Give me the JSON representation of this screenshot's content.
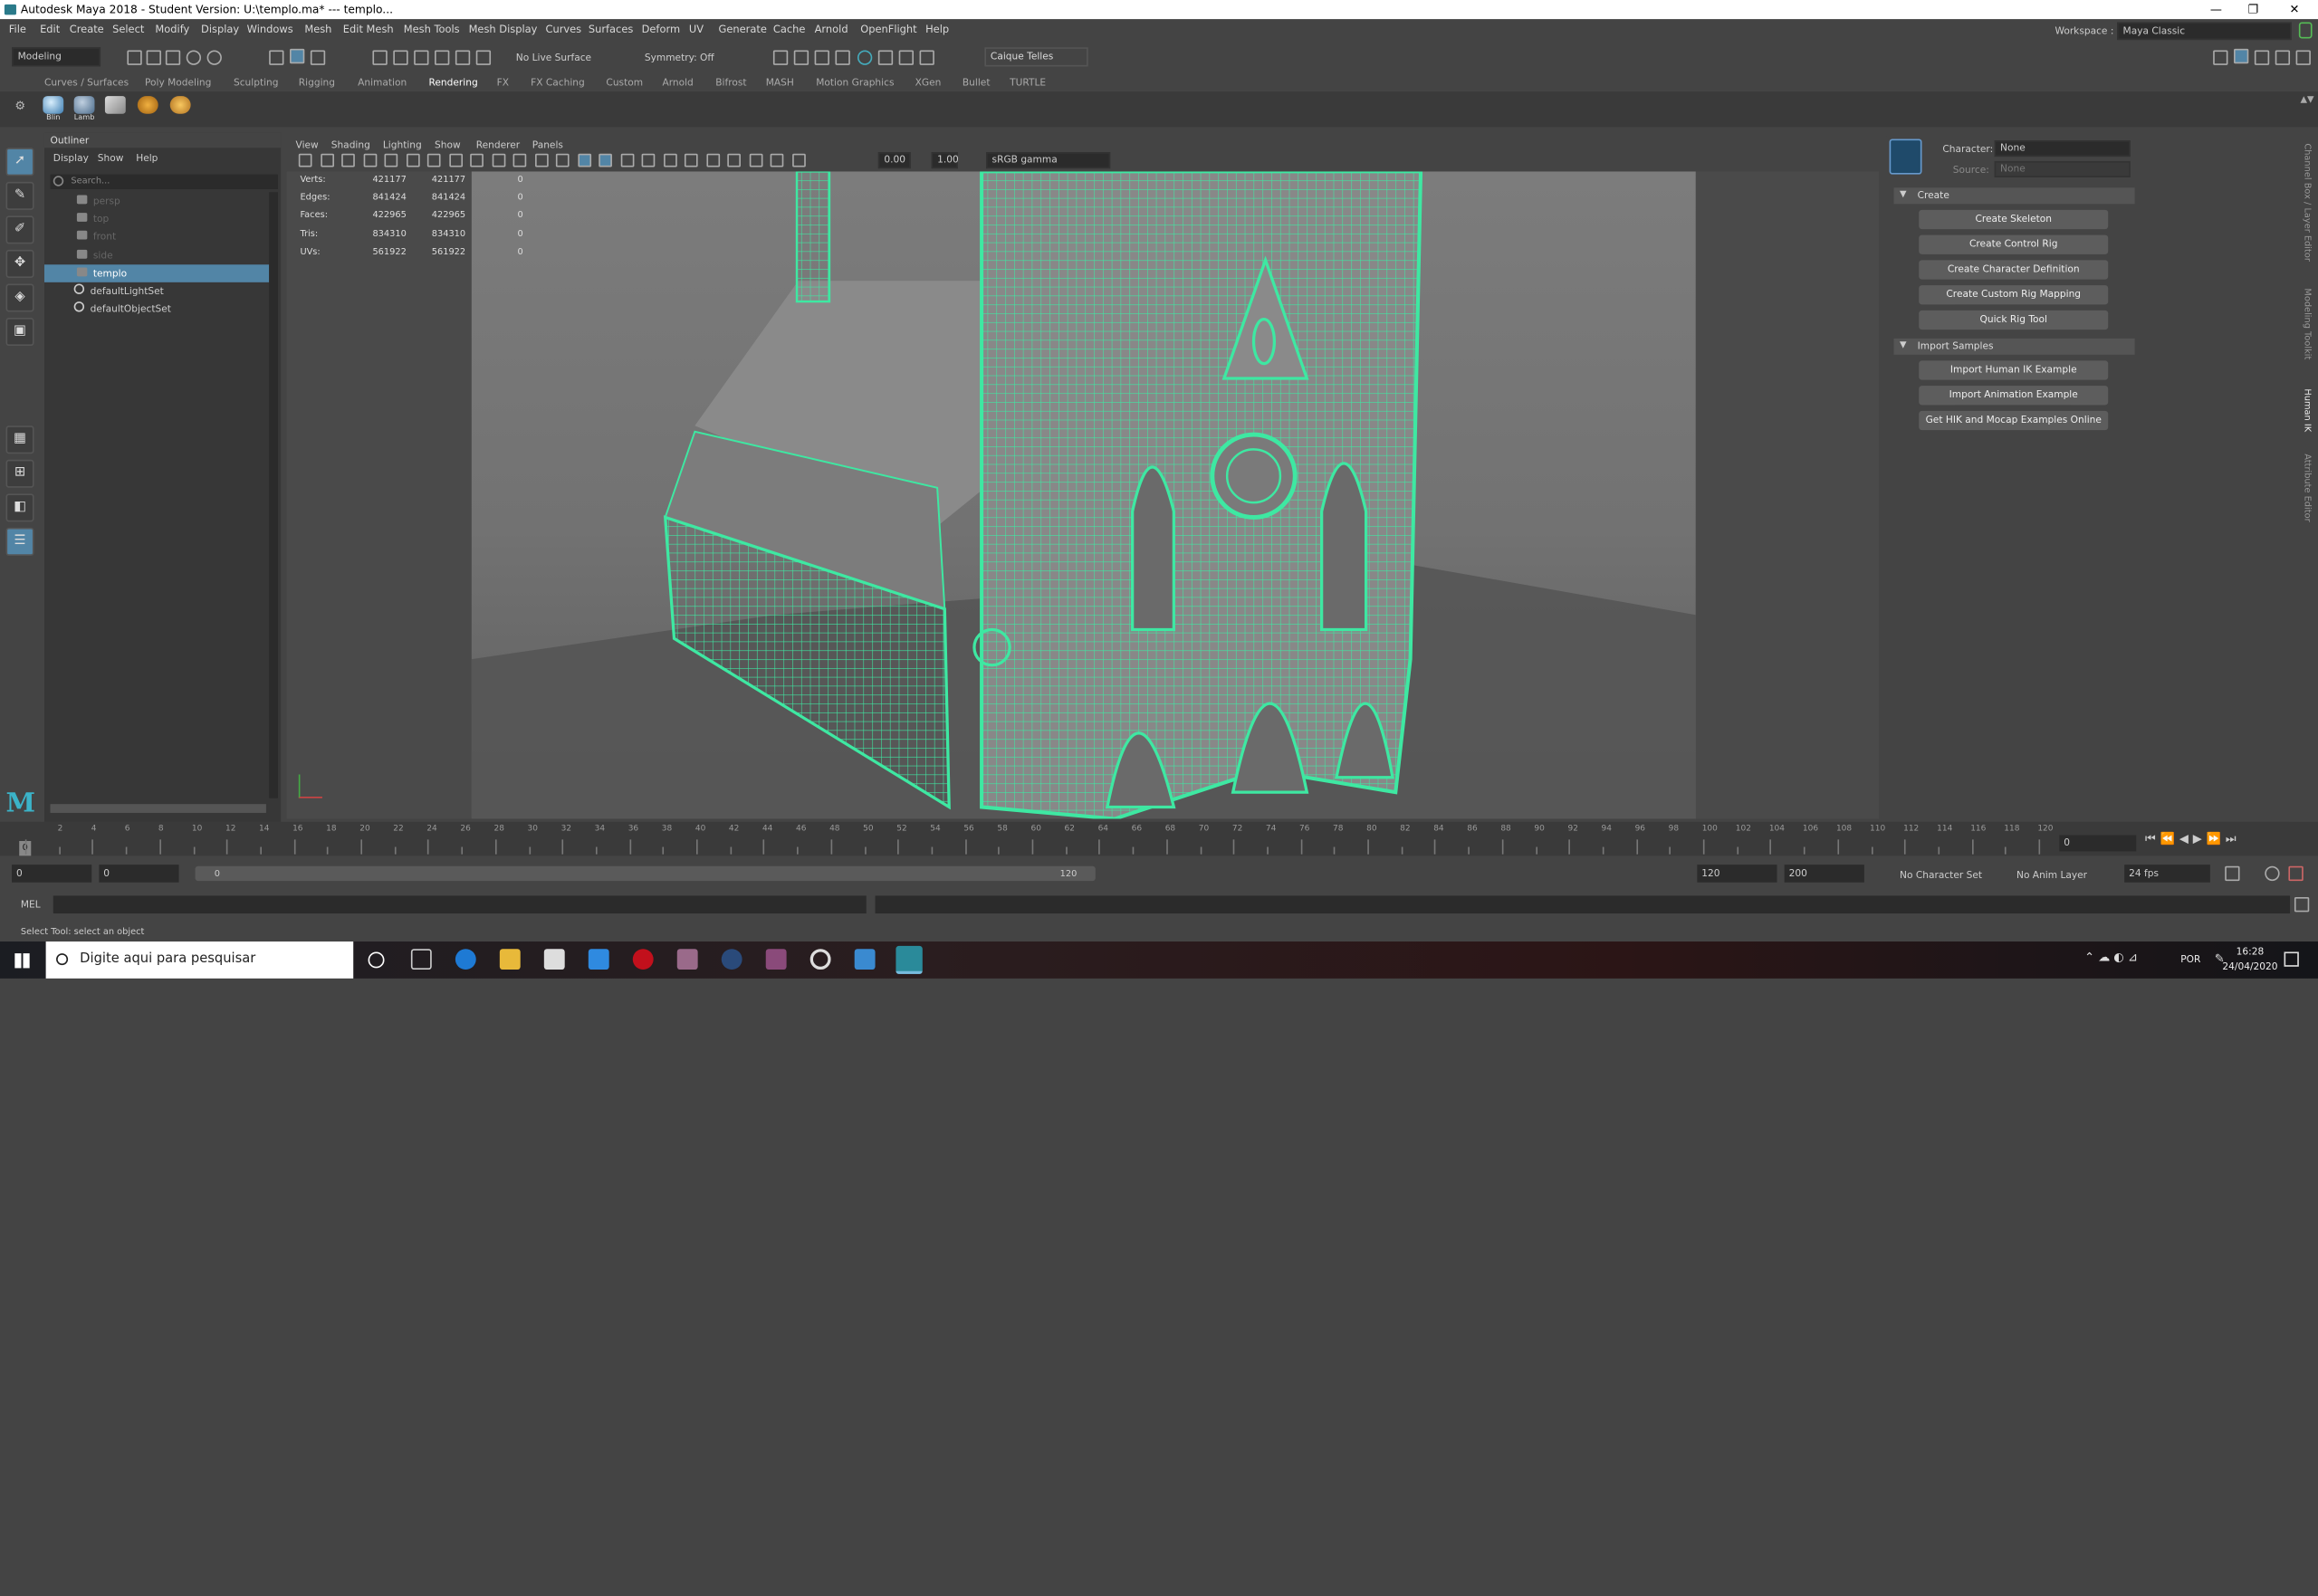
{
  "window": {
    "title": "Autodesk Maya 2018 - Student Version: U:\\templo.ma*   ---   templo...",
    "minimize": "—",
    "maximize": "❐",
    "close": "✕"
  },
  "menubar": [
    "File",
    "Edit",
    "Create",
    "Select",
    "Modify",
    "Display",
    "Windows",
    "Mesh",
    "Edit Mesh",
    "Mesh Tools",
    "Mesh Display",
    "Curves",
    "Surfaces",
    "Deform",
    "UV",
    "Generate",
    "Cache",
    "Arnold",
    "OpenFlight",
    "Help"
  ],
  "workspace": {
    "label": "Workspace :",
    "value": "Maya Classic"
  },
  "statusline": {
    "mode": "Modeling",
    "live": "No Live Surface",
    "symmetry": "Symmetry: Off",
    "user": "Caique Telles"
  },
  "shelf_tabs": [
    "Curves / Surfaces",
    "Poly Modeling",
    "Sculpting",
    "Rigging",
    "Animation",
    "Rendering",
    "FX",
    "FX Caching",
    "Custom",
    "Arnold",
    "Bifrost",
    "MASH",
    "Motion Graphics",
    "XGen",
    "Bullet",
    "TURTLE"
  ],
  "shelf_active": "Rendering",
  "shelf_buttons": [
    "Blin",
    "Lamb",
    "",
    ""
  ],
  "outliner": {
    "title": "Outliner",
    "menu": [
      "Display",
      "Show",
      "Help"
    ],
    "search_placeholder": "Search...",
    "items": [
      {
        "label": "persp",
        "state": "dim"
      },
      {
        "label": "top",
        "state": "dim"
      },
      {
        "label": "front",
        "state": "dim"
      },
      {
        "label": "side",
        "state": "dim"
      },
      {
        "label": "templo",
        "state": "sel"
      },
      {
        "label": "defaultLightSet",
        "state": "set"
      },
      {
        "label": "defaultObjectSet",
        "state": "set"
      }
    ]
  },
  "viewport": {
    "menu": [
      "View",
      "Shading",
      "Lighting",
      "Show",
      "Renderer",
      "Panels"
    ],
    "exposure": "0.00",
    "gamma": "1.00",
    "colorspace": "sRGB gamma",
    "hud": [
      {
        "label": "Verts:",
        "a": "421177",
        "b": "421177",
        "c": "0"
      },
      {
        "label": "Edges:",
        "a": "841424",
        "b": "841424",
        "c": "0"
      },
      {
        "label": "Faces:",
        "a": "422965",
        "b": "422965",
        "c": "0"
      },
      {
        "label": "Tris:",
        "a": "834310",
        "b": "834310",
        "c": "0"
      },
      {
        "label": "UVs:",
        "a": "561922",
        "b": "561922",
        "c": "0"
      }
    ]
  },
  "hik": {
    "character_label": "Character:",
    "character_value": "None",
    "source_label": "Source:",
    "source_value": "None",
    "create_section": "Create",
    "create_buttons": [
      "Create Skeleton",
      "Create Control Rig",
      "Create Character Definition",
      "Create Custom Rig Mapping",
      "Quick Rig Tool"
    ],
    "import_section": "Import Samples",
    "import_buttons": [
      "Import Human IK Example",
      "Import Animation Example",
      "Get HIK and Mocap Examples Online"
    ]
  },
  "side_tabs": [
    "Channel Box / Layer Editor",
    "Modeling Toolkit",
    "Human IK",
    "Attribute Editor"
  ],
  "timeline": {
    "ticks": [
      "2",
      "4",
      "6",
      "8",
      "10",
      "12",
      "14",
      "16",
      "18",
      "20",
      "22",
      "24",
      "26",
      "28",
      "30",
      "32",
      "34",
      "36",
      "38",
      "40",
      "42",
      "44",
      "46",
      "48",
      "50",
      "52",
      "54",
      "56",
      "58",
      "60",
      "62",
      "64",
      "66",
      "68",
      "70",
      "72",
      "74",
      "76",
      "78",
      "80",
      "82",
      "84",
      "86",
      "88",
      "90",
      "92",
      "94",
      "96",
      "98",
      "100",
      "102",
      "104",
      "106",
      "108",
      "110",
      "112",
      "114",
      "116",
      "118",
      "120"
    ],
    "current_frame": "0",
    "playhead_label": "0"
  },
  "range": {
    "start": "0",
    "start2": "0",
    "slider_start": "0",
    "slider_end": "120",
    "end": "120",
    "end2": "200",
    "char_set": "No Character Set",
    "anim_layer": "No Anim Layer",
    "fps": "24 fps"
  },
  "cmdline": {
    "label": "MEL"
  },
  "helpline": "Select Tool: select an object",
  "taskbar": {
    "search": "Digite aqui para pesquisar",
    "lang": "POR",
    "time": "16:28",
    "date": "24/04/2020"
  }
}
